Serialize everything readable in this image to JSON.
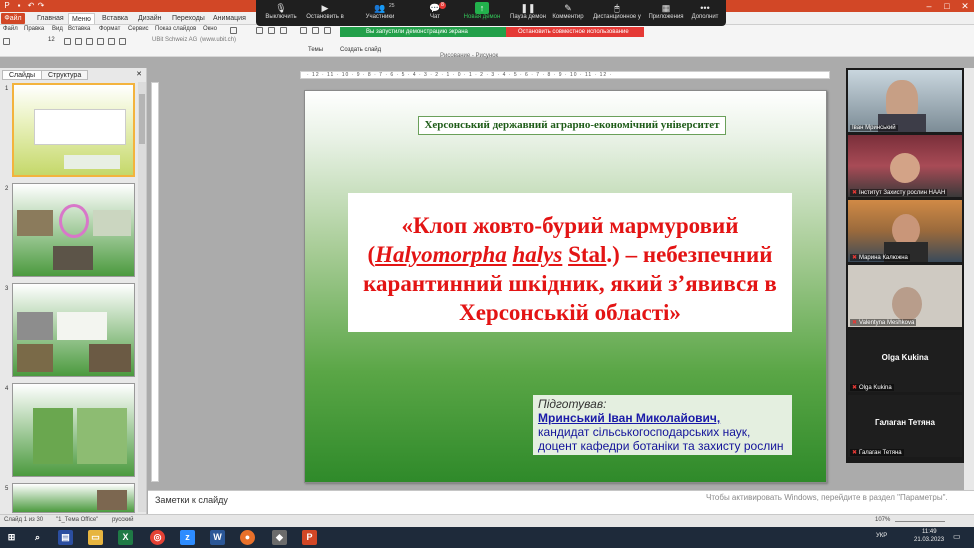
{
  "ribbon_tabs": [
    "Файл",
    "Главная",
    "Меню",
    "Вставка",
    "Дизайн",
    "Переходы",
    "Анимация"
  ],
  "menu_items": [
    "Файл",
    "Правка",
    "Вид",
    "Вставка",
    "Формат",
    "Сервис",
    "Показ слайдов",
    "Окно"
  ],
  "toolbar": {
    "font_size": "12",
    "themes_label": "Темы",
    "create_slide_label": "Создать слайд",
    "drawing_label": "Рисование - Рисунок",
    "vendor_label": "UBit Schweiz AG",
    "vendor_url_label": "(www.ubit.ch)"
  },
  "zoom_bar": {
    "items": [
      {
        "label": "Выключить",
        "icon": "mic-icon",
        "glyph": "🎙"
      },
      {
        "label": "Остановить в",
        "icon": "video-icon",
        "glyph": "▶"
      },
      {
        "label": "Участники",
        "icon": "participants-icon",
        "glyph": "👥"
      },
      {
        "label": "Чат",
        "icon": "chat-icon",
        "glyph": "💬"
      },
      {
        "label": "Новая демон",
        "icon": "share-icon",
        "glyph": "↑"
      },
      {
        "label": "Пауза демон",
        "icon": "pause-icon",
        "glyph": "❚❚"
      },
      {
        "label": "Комментир",
        "icon": "annotate-icon",
        "glyph": "✎"
      },
      {
        "label": "Дистанционное у",
        "icon": "remote-control-icon",
        "glyph": "🖱"
      },
      {
        "label": "Приложения",
        "icon": "apps-icon",
        "glyph": "▦"
      },
      {
        "label": "Дополнит",
        "icon": "more-icon",
        "glyph": "•••"
      }
    ],
    "participant_count": "25",
    "chat_badge": "8"
  },
  "share_banner": {
    "status": "Вы запустили демонстрацию экрана",
    "stop": "Остановить совместное использование"
  },
  "left_panel": {
    "tabs": [
      "Слайды",
      "Структура"
    ],
    "slides": [
      {
        "num": "1"
      },
      {
        "num": "2"
      },
      {
        "num": "3"
      },
      {
        "num": "4"
      },
      {
        "num": "5"
      }
    ]
  },
  "slide": {
    "university": "Херсонський державний аграрно-економічний університет",
    "title_part1": "«Клоп жовто-бурий мармуровий (",
    "title_genus": "Halyomorpha",
    "title_species": "halys",
    "title_author": "Stal",
    "title_part2": ".) – небезпечний карантинний шкідник, який з’явився в Херсонській області»",
    "prepared_label": "Підготував:",
    "author_name": "Мринський Іван Миколайович,",
    "author_desc": "кандидат сільськогосподарських наук, доцент кафедри ботаніки та захисту рослин"
  },
  "notes_placeholder": "Заметки к слайду",
  "activate_windows": "Чтобы активировать Windows, перейдите в раздел \"Параметры\".",
  "status_bar": {
    "slide_info": "Слайд 1 из 30",
    "theme": "\"1_Тема Office\"",
    "language": "русский",
    "zoom": "107%"
  },
  "participants": [
    {
      "name": "Іван Мринський",
      "muted": false,
      "video": true
    },
    {
      "name": "Інститут Захисту рослин НААН",
      "muted": true,
      "video": true
    },
    {
      "name": "Марина Калюжна",
      "muted": true,
      "video": true
    },
    {
      "name": "Valentyna Meshkova",
      "muted": true,
      "video": true
    },
    {
      "name": "Olga Kukina",
      "muted": true,
      "video": false
    },
    {
      "name": "Галаган Тетяна",
      "muted": true,
      "video": false
    }
  ],
  "tray": {
    "lang": "УКР",
    "time": "11:49",
    "date": "21.03.2023"
  }
}
